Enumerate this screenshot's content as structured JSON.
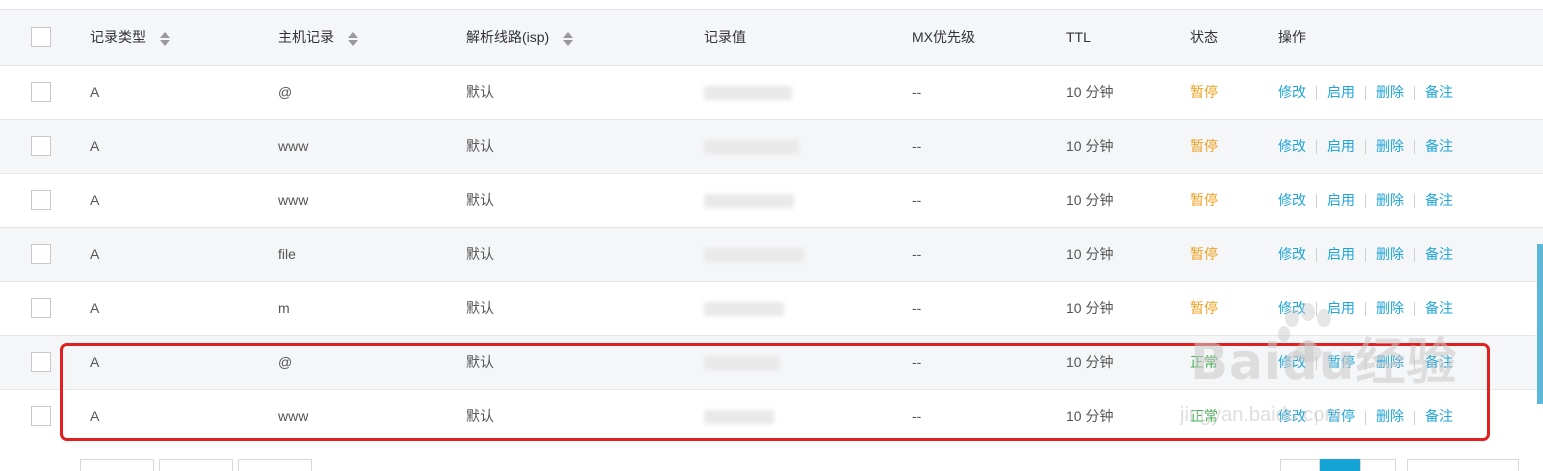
{
  "header": {
    "type": "记录类型",
    "host": "主机记录",
    "line": "解析线路(isp)",
    "value": "记录值",
    "mx": "MX优先级",
    "ttl": "TTL",
    "status": "状态",
    "ops": "操作"
  },
  "rows": [
    {
      "type": "A",
      "host": "@",
      "line": "默认",
      "mx": "--",
      "ttl": "10 分钟",
      "status": "暂停",
      "ops": [
        "修改",
        "启用",
        "删除",
        "备注"
      ]
    },
    {
      "type": "A",
      "host": "www",
      "line": "默认",
      "mx": "--",
      "ttl": "10 分钟",
      "status": "暂停",
      "ops": [
        "修改",
        "启用",
        "删除",
        "备注"
      ]
    },
    {
      "type": "A",
      "host": "www",
      "line": "默认",
      "mx": "--",
      "ttl": "10 分钟",
      "status": "暂停",
      "ops": [
        "修改",
        "启用",
        "删除",
        "备注"
      ]
    },
    {
      "type": "A",
      "host": "file",
      "line": "默认",
      "mx": "--",
      "ttl": "10 分钟",
      "status": "暂停",
      "ops": [
        "修改",
        "启用",
        "删除",
        "备注"
      ]
    },
    {
      "type": "A",
      "host": "m",
      "line": "默认",
      "mx": "--",
      "ttl": "10 分钟",
      "status": "暂停",
      "ops": [
        "修改",
        "启用",
        "删除",
        "备注"
      ]
    },
    {
      "type": "A",
      "host": "@",
      "line": "默认",
      "mx": "--",
      "ttl": "10 分钟",
      "status": "正常",
      "ops": [
        "修改",
        "暂停",
        "删除",
        "备注"
      ]
    },
    {
      "type": "A",
      "host": "www",
      "line": "默认",
      "mx": "--",
      "ttl": "10 分钟",
      "status": "正常",
      "ops": [
        "修改",
        "暂停",
        "删除",
        "备注"
      ]
    }
  ],
  "watermark": {
    "main": "Baidu经验",
    "sub": "jingyan.baidu.com"
  },
  "colors": {
    "pause": "#f0a020",
    "normal": "#3db04a",
    "link": "#1fa5d8",
    "highlight": "#e0211f"
  }
}
